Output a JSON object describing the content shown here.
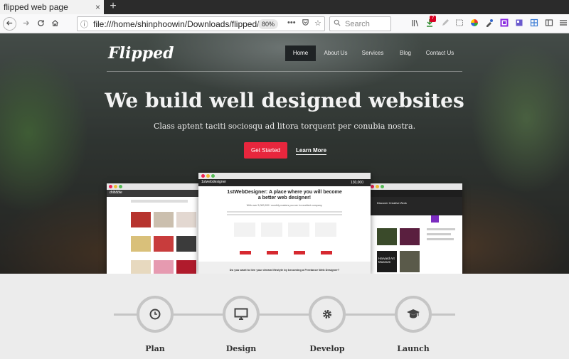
{
  "browser": {
    "tab_title": "flipped web page",
    "tab_close": "×",
    "new_tab": "+",
    "url": "file:///home/shinphoowin/Downloads/flipped/",
    "zoom": "80%",
    "url_more": "•••",
    "search_placeholder": "Search",
    "notification_count": "7"
  },
  "site": {
    "logo": "Flipped",
    "menu": [
      "Home",
      "About Us",
      "Services",
      "Blog",
      "Contact Us"
    ],
    "active_menu": "Home",
    "headline": "We build well designed websites",
    "subheadline": "Class aptent taciti sociosqu ad litora torquent per conubia nostra.",
    "primary_button": "Get Started",
    "secondary_link": "Learn More"
  },
  "showcase": {
    "left_logo": "dribbble",
    "center_logo": "1stwebdesigner",
    "center_title": "1stWebDesigner: A place where you will become a better web designer!",
    "center_subtitle": "With over 5,000,000+ monthly readers you are in excellent company.",
    "center_count": "130,000",
    "center_footer": "Do you want to live your dream lifestyle by becoming a Freelance Web Designer?",
    "right_heading": "Discover Creative Work",
    "right_tile": "Harvard Art Museum"
  },
  "process": {
    "steps": [
      {
        "label": "Plan",
        "icon": "clock-icon"
      },
      {
        "label": "Design",
        "icon": "monitor-icon"
      },
      {
        "label": "Develop",
        "icon": "gear-icon"
      },
      {
        "label": "Launch",
        "icon": "graduation-cap-icon"
      }
    ]
  },
  "colors": {
    "accent_red": "#e8263d",
    "menu_active": "#1f2325",
    "step_ring": "#c5c5c5"
  }
}
